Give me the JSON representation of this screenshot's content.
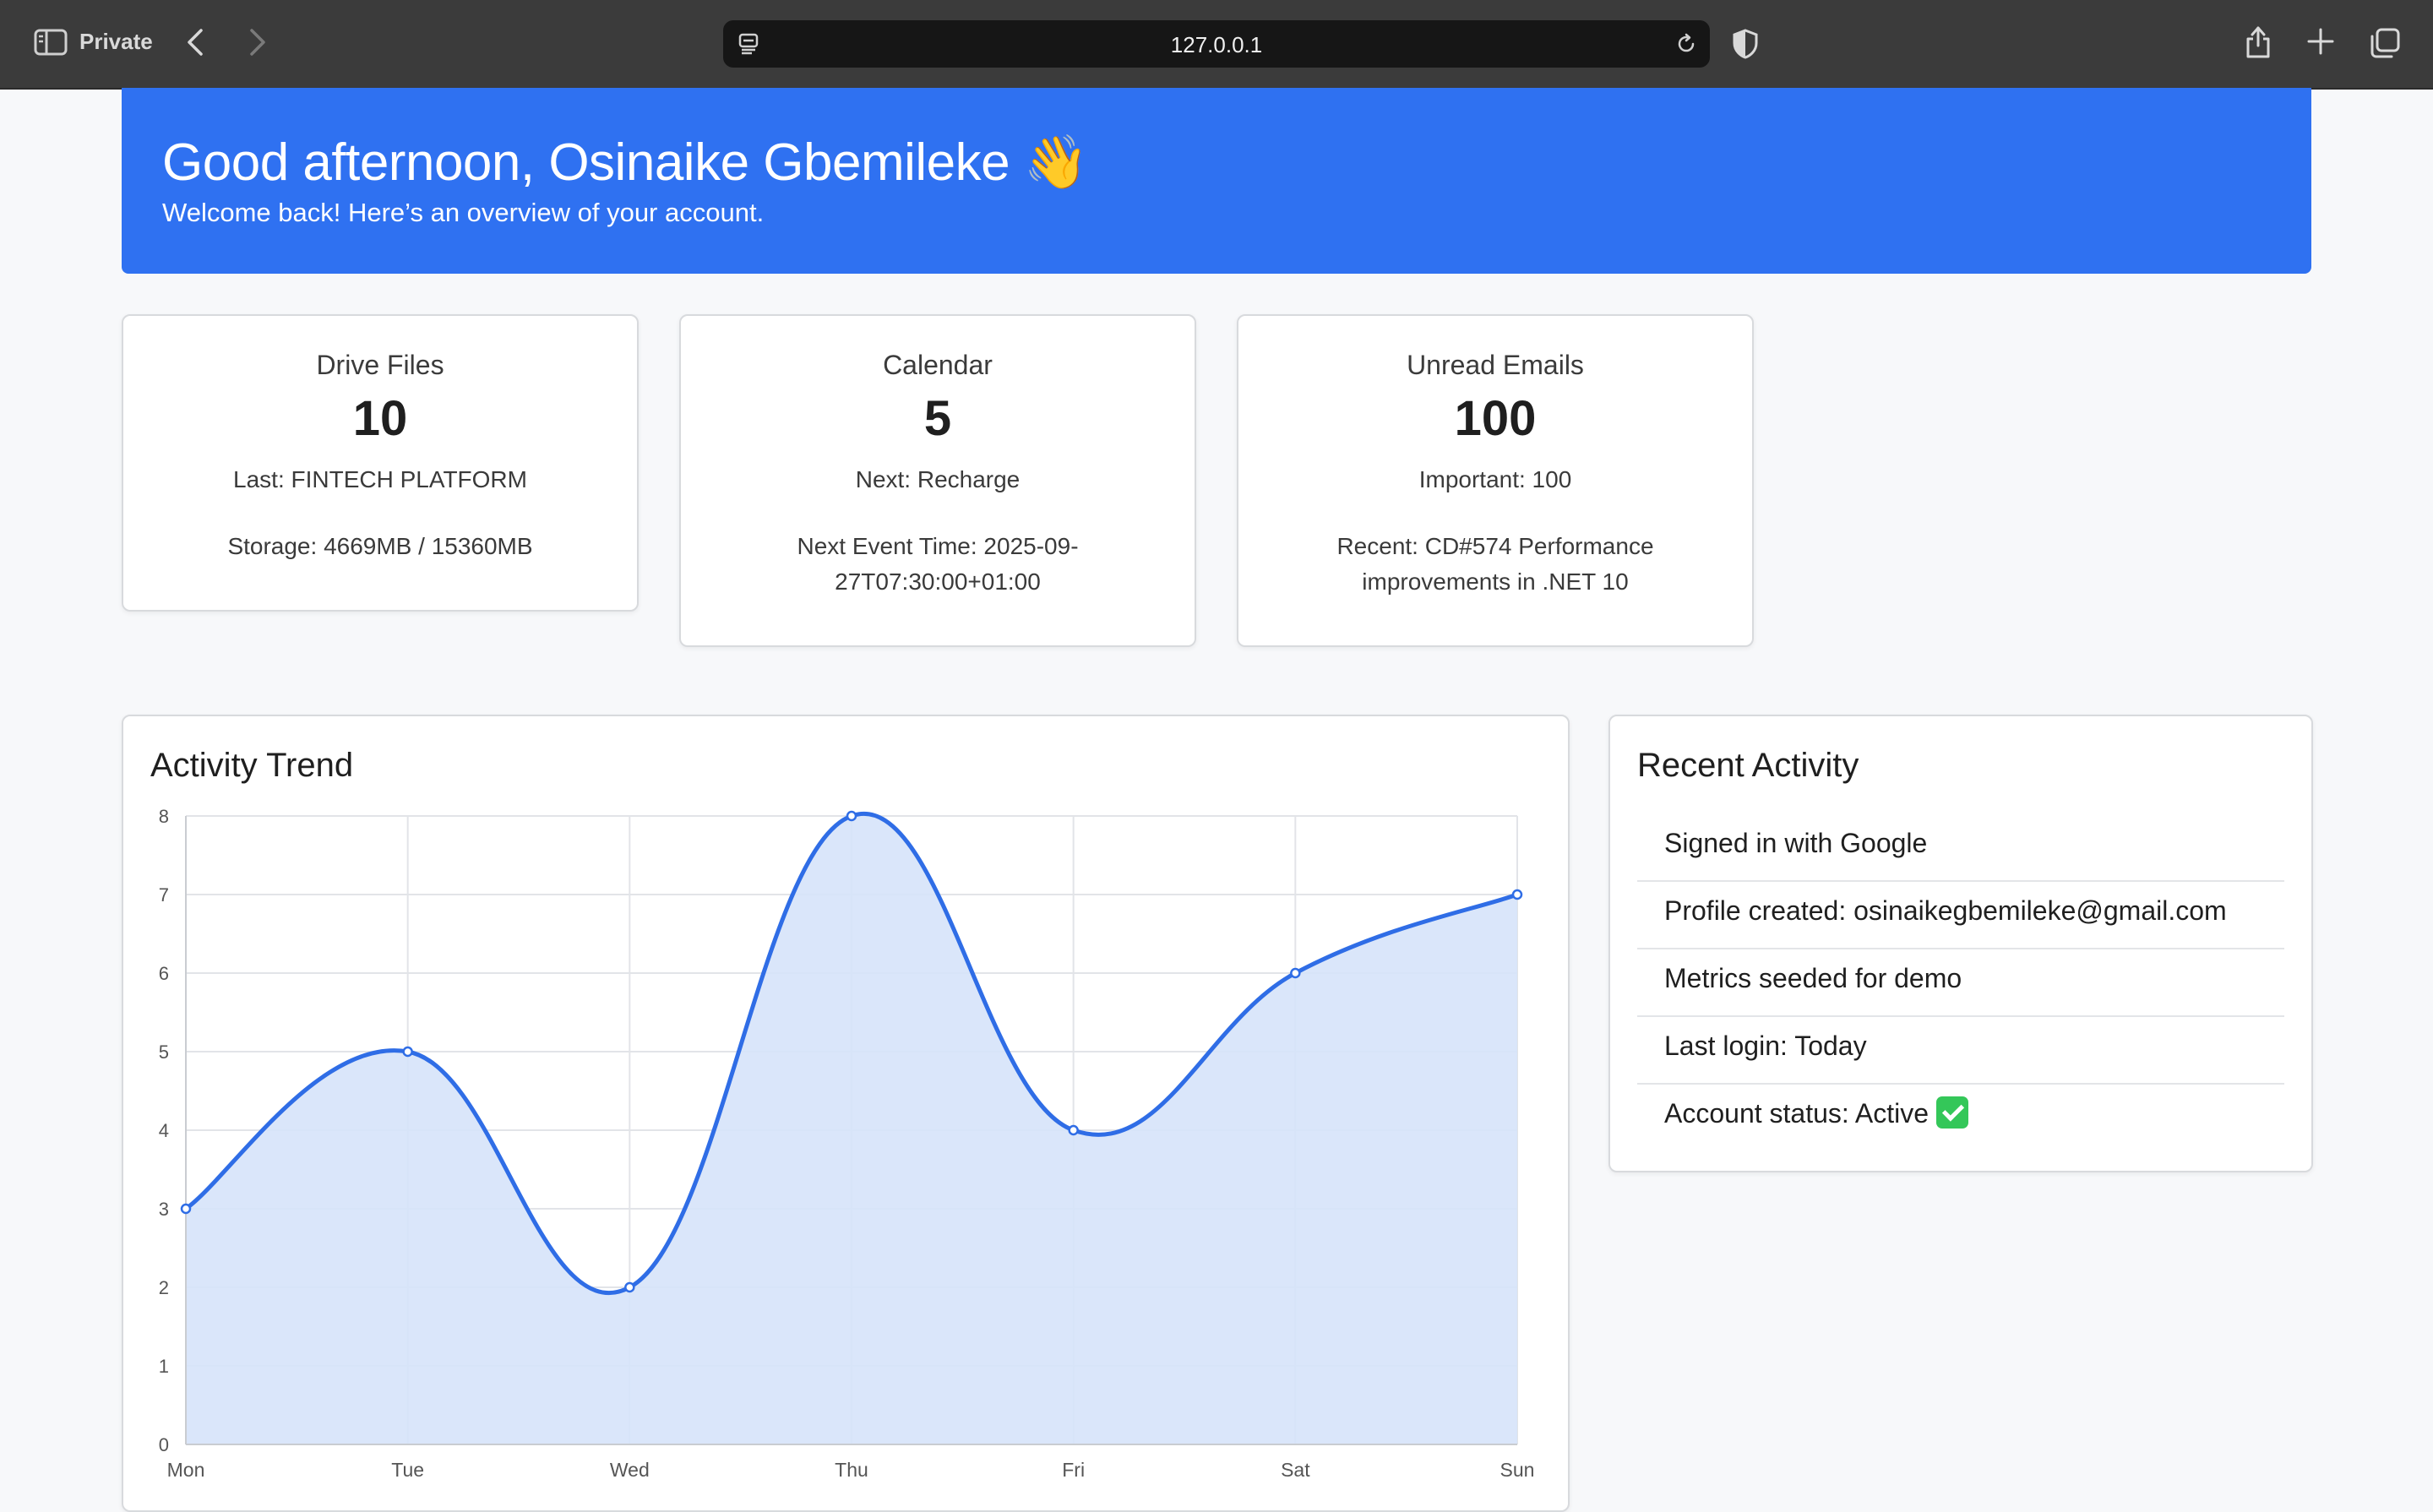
{
  "browser": {
    "mode_label": "Private",
    "url": "127.0.0.1"
  },
  "banner": {
    "greeting": "Good afternoon, Osinaike Gbemileke 👋",
    "subtitle": "Welcome back! Here’s an overview of your account.",
    "color": "#2f71f1"
  },
  "stats": [
    {
      "title": "Drive Files",
      "value": "10",
      "line1": "Last: FINTECH PLATFORM",
      "line2": "Storage: 4669MB / 15360MB"
    },
    {
      "title": "Calendar",
      "value": "5",
      "line1": "Next: Recharge",
      "line2": "Next Event Time: 2025-09-27T07:30:00+01:00"
    },
    {
      "title": "Unread Emails",
      "value": "100",
      "line1": "Important: 100",
      "line2": "Recent: CD#574 Performance improvements in .NET 10"
    }
  ],
  "activity_trend": {
    "title": "Activity Trend"
  },
  "recent_activity": {
    "title": "Recent Activity",
    "items": [
      "Signed in with Google",
      "Profile created: osinaikegbemileke@gmail.com",
      "Metrics seeded for demo",
      "Last login: Today",
      "Account status: Active"
    ],
    "status_icon": "check-mark-icon"
  },
  "chart_data": {
    "type": "area",
    "title": "Activity Trend",
    "categories": [
      "Mon",
      "Tue",
      "Wed",
      "Thu",
      "Fri",
      "Sat",
      "Sun"
    ],
    "values": [
      3,
      5,
      2,
      8,
      4,
      6,
      7
    ],
    "xlabel": "",
    "ylabel": "",
    "ylim": [
      0,
      8
    ],
    "yticks": [
      0,
      1,
      2,
      3,
      4,
      5,
      6,
      7,
      8
    ],
    "grid": true,
    "line_color": "#2f6de6",
    "fill_color": "#d6e3fa"
  }
}
